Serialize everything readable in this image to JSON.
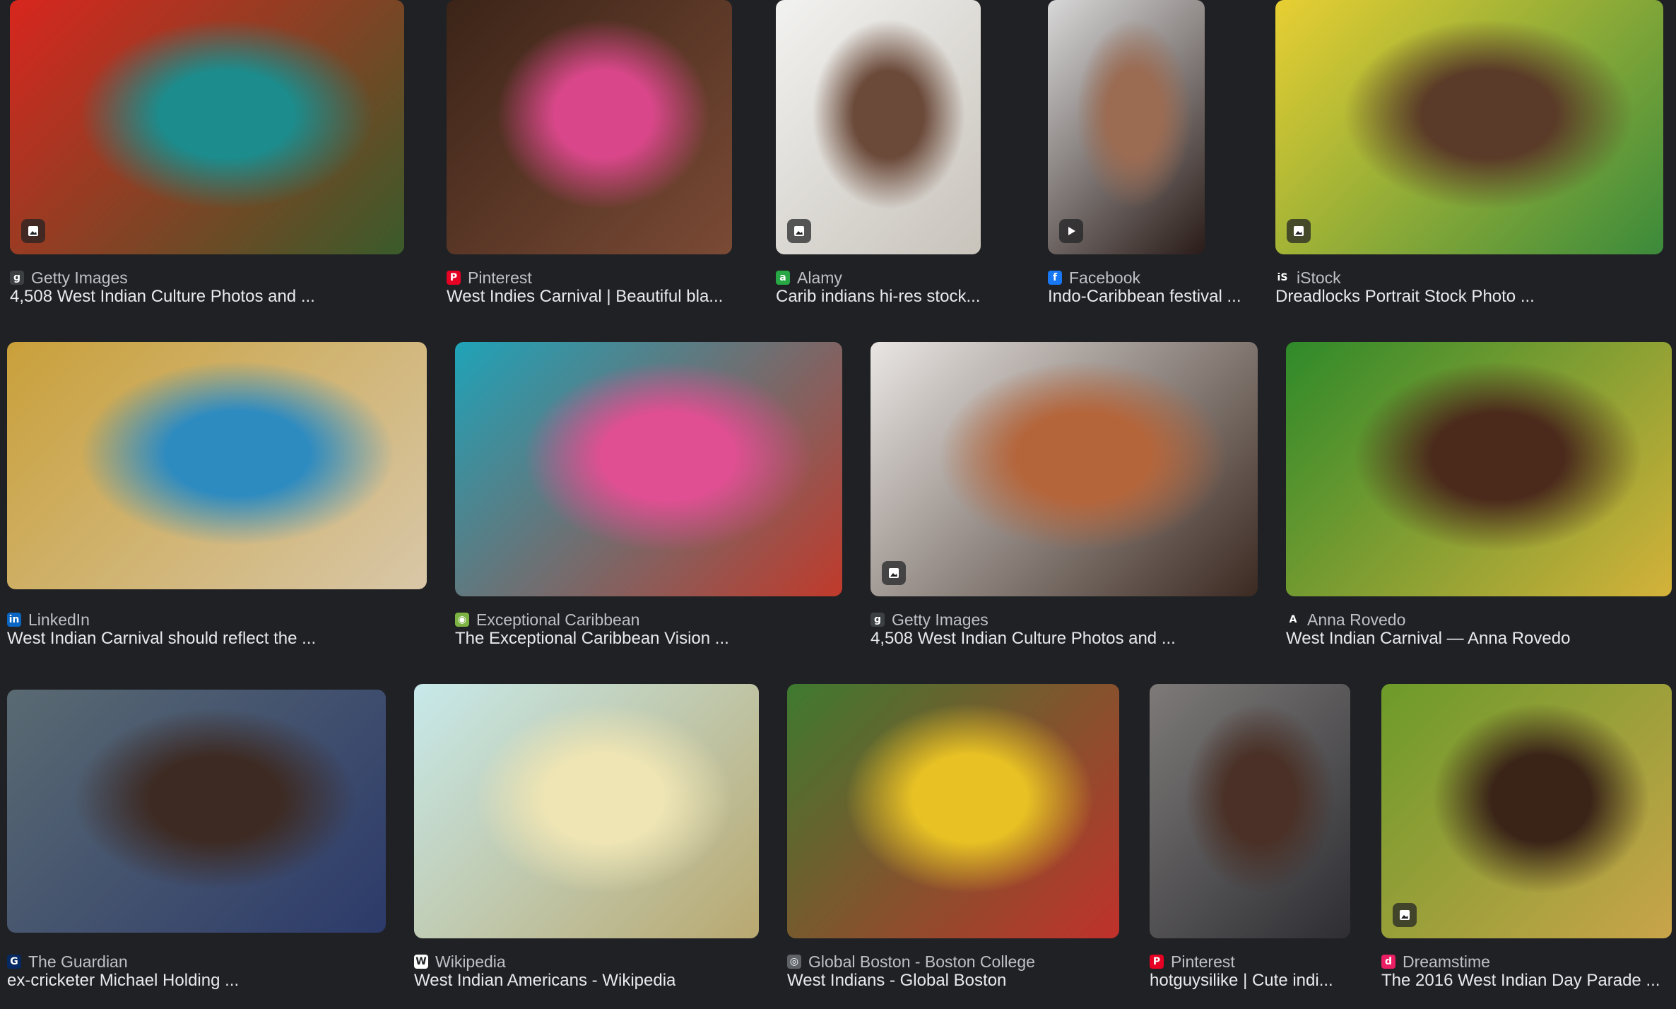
{
  "results": [
    {
      "source": "Getty Images",
      "title": "4,508 West Indian Culture Photos and ...",
      "favicon": "getty-icon",
      "favicon_char": "g",
      "favicon_bg": "#3c4043",
      "badge": "image-icon",
      "thumb_desc": "carnival dancer in red and teal feathers",
      "colors": [
        "#d8261e",
        "#1c8c8c",
        "#3a5b2a"
      ]
    },
    {
      "source": "Pinterest",
      "title": "West Indies Carnival | Beautiful bla...",
      "favicon": "pinterest-icon",
      "favicon_char": "P",
      "favicon_bg": "#e60023",
      "badge": null,
      "thumb_desc": "child with pink beaded braids",
      "colors": [
        "#3b2418",
        "#d9478a",
        "#7a4a35"
      ]
    },
    {
      "source": "Alamy",
      "title": "Carib indians hi-res stock...",
      "favicon": "alamy-icon",
      "favicon_char": "a",
      "favicon_bg": "#28a745",
      "badge": "image-icon",
      "thumb_desc": "woman holding child, face paint",
      "colors": [
        "#f2f2f0",
        "#6b4a3a",
        "#c8c3bb"
      ]
    },
    {
      "source": "Facebook",
      "title": "Indo-Caribbean festival ...",
      "favicon": "facebook-icon",
      "favicon_char": "f",
      "favicon_bg": "#1877f2",
      "badge": "play-icon",
      "thumb_desc": "smiling woman portrait",
      "colors": [
        "#d8d8d8",
        "#9b6b52",
        "#2a1c18"
      ]
    },
    {
      "source": "iStock",
      "title": "Dreadlocks Portrait Stock Photo ...",
      "favicon": "istock-icon",
      "favicon_char": "iS",
      "favicon_bg": "#202124",
      "badge": "image-icon",
      "thumb_desc": "woman with braids, yellow wall",
      "colors": [
        "#e8cf33",
        "#5a3a28",
        "#3b8a3b"
      ]
    },
    {
      "source": "LinkedIn",
      "title": "West Indian Carnival should reflect the ...",
      "favicon": "linkedin-icon",
      "favicon_char": "in",
      "favicon_bg": "#0a66c2",
      "badge": null,
      "thumb_desc": "three women in carnival costumes",
      "colors": [
        "#c9a03a",
        "#2e8bc0",
        "#d8c7a8"
      ]
    },
    {
      "source": "Exceptional Caribbean",
      "title": "The Exceptional Caribbean Vision ...",
      "favicon": "exceptional-caribbean-icon",
      "favicon_char": "◉",
      "favicon_bg": "#7cb342",
      "badge": null,
      "thumb_desc": "woman with colorful feathered headdress",
      "colors": [
        "#1fa3b8",
        "#e04f92",
        "#c03a2b"
      ]
    },
    {
      "source": "Getty Images",
      "title": "4,508 West Indian Culture Photos and ...",
      "favicon": "getty-icon",
      "favicon_char": "g",
      "favicon_bg": "#3c4043",
      "badge": "image-icon",
      "thumb_desc": "dancer in white and orange feathers",
      "colors": [
        "#e9e6e3",
        "#b5653a",
        "#3b2a22"
      ]
    },
    {
      "source": "Anna Rovedo",
      "title": "West Indian Carnival — Anna Rovedo",
      "favicon": "anna-rovedo-icon",
      "favicon_char": "A",
      "favicon_bg": "#202124",
      "badge": null,
      "thumb_desc": "smiling woman in green feathers",
      "colors": [
        "#2f8a2a",
        "#4b2a1c",
        "#d4b23a"
      ]
    },
    {
      "source": "The Guardian",
      "title": "ex-cricketer Michael Holding ...",
      "favicon": "guardian-icon",
      "favicon_char": "G",
      "favicon_bg": "#052962",
      "badge": null,
      "thumb_desc": "older man portrait",
      "colors": [
        "#5a6a72",
        "#3d2a22",
        "#2c3a6a"
      ]
    },
    {
      "source": "Wikipedia",
      "title": "West Indian Americans - Wikipedia",
      "favicon": "wikipedia-icon",
      "favicon_char": "W",
      "favicon_bg": "#ffffff",
      "badge": null,
      "thumb_desc": "map of United States counties",
      "colors": [
        "#c7e9ea",
        "#efe5b4",
        "#b9a870"
      ]
    },
    {
      "source": "Global Boston - Boston College",
      "title": "West Indians - Global Boston",
      "favicon": "global-boston-icon",
      "favicon_char": "◎",
      "favicon_bg": "#5f6368",
      "badge": null,
      "thumb_desc": "parade with flags",
      "colors": [
        "#3e7a30",
        "#e8c224",
        "#c0312b"
      ]
    },
    {
      "source": "Pinterest",
      "title": "hotguysilike | Cute indi...",
      "favicon": "pinterest-icon",
      "favicon_char": "P",
      "favicon_bg": "#e60023",
      "badge": null,
      "thumb_desc": "young man portrait",
      "colors": [
        "#7d7a78",
        "#4a3026",
        "#2e2e33"
      ]
    },
    {
      "source": "Dreamstime",
      "title": "The 2016 West Indian Day Parade ...",
      "favicon": "dreamstime-icon",
      "favicon_char": "d",
      "favicon_bg": "#e91e63",
      "badge": "image-icon",
      "thumb_desc": "dancers in gold and green costumes",
      "colors": [
        "#6c9b2a",
        "#3a2418",
        "#c9a44a"
      ]
    }
  ]
}
